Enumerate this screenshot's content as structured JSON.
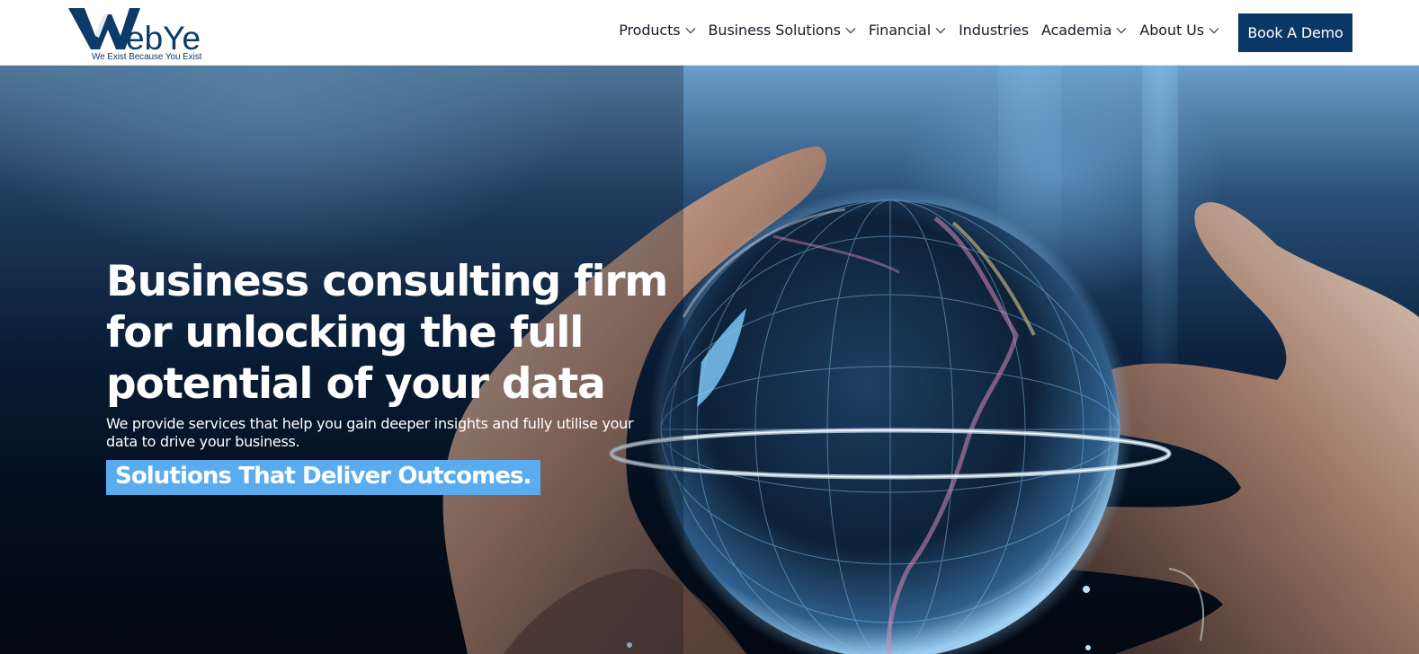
{
  "brand": {
    "name": "WebYe",
    "logo_letters": "ebYe",
    "tagline": "We Exist Because You Exist",
    "primary_color": "#0b3767"
  },
  "nav": {
    "items": [
      {
        "label": "Products",
        "has_dropdown": true,
        "icon": "chevron-down-icon"
      },
      {
        "label": "Business Solutions",
        "has_dropdown": true,
        "icon": "chevron-down-icon"
      },
      {
        "label": "Financial",
        "has_dropdown": true,
        "icon": "chevron-down-icon"
      },
      {
        "label": "Industries",
        "has_dropdown": false
      },
      {
        "label": "Academia",
        "has_dropdown": true,
        "icon": "chevron-down-icon"
      },
      {
        "label": "About Us",
        "has_dropdown": true,
        "icon": "chevron-down-icon"
      }
    ],
    "cta_label": "Book A Demo"
  },
  "hero": {
    "title_line_1": "Business consulting firm",
    "title_line_2": "for unlocking the full",
    "title_line_3": "potential of your data",
    "subtitle": "We provide services that help you gain deeper insights and fully utilise your data to drive your business.",
    "badge": "Solutions That Deliver Outcomes.",
    "badge_color": "#5aacee",
    "image": "hands-holding-glowing-globe"
  }
}
